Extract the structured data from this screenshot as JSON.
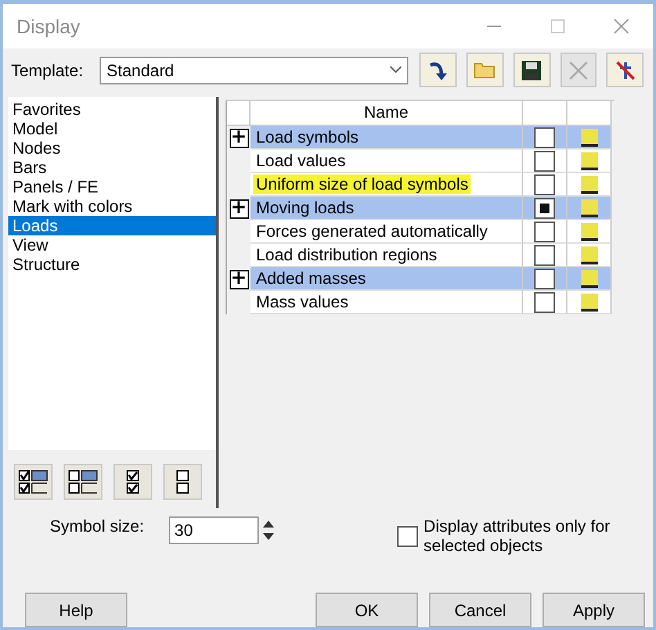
{
  "window": {
    "title": "Display"
  },
  "template": {
    "label": "Template:",
    "value": "Standard"
  },
  "categories": [
    {
      "label": "Favorites",
      "selected": false
    },
    {
      "label": "Model",
      "selected": false
    },
    {
      "label": "Nodes",
      "selected": false
    },
    {
      "label": "Bars",
      "selected": false
    },
    {
      "label": "Panels / FE",
      "selected": false
    },
    {
      "label": "Mark with colors",
      "selected": false
    },
    {
      "label": "Loads",
      "selected": true
    },
    {
      "label": "View",
      "selected": false
    },
    {
      "label": "Structure",
      "selected": false
    }
  ],
  "table": {
    "columns": [
      "Name"
    ],
    "rows": [
      {
        "kind": "group",
        "expander": "+",
        "name": "Load symbols",
        "checked": false,
        "highlighted": false
      },
      {
        "kind": "item",
        "name": "Load values",
        "checked": false,
        "highlighted": false
      },
      {
        "kind": "item",
        "name": "Uniform size of load symbols",
        "checked": false,
        "highlighted": true
      },
      {
        "kind": "group",
        "expander": "+",
        "name": "Moving loads",
        "checked": true,
        "highlighted": false
      },
      {
        "kind": "item",
        "name": "Forces generated automatically",
        "checked": false,
        "highlighted": false
      },
      {
        "kind": "item",
        "name": "Load distribution regions",
        "checked": false,
        "highlighted": false
      },
      {
        "kind": "group",
        "expander": "+",
        "name": "Added masses",
        "checked": false,
        "highlighted": false
      },
      {
        "kind": "item",
        "name": "Mass values",
        "checked": false,
        "highlighted": false
      }
    ]
  },
  "symbol_size": {
    "label": "Symbol size:",
    "value": "30"
  },
  "selected_only": {
    "label": "Display attributes only for selected objects",
    "checked": false
  },
  "buttons": [
    "Help",
    "OK",
    "Cancel",
    "Apply"
  ]
}
